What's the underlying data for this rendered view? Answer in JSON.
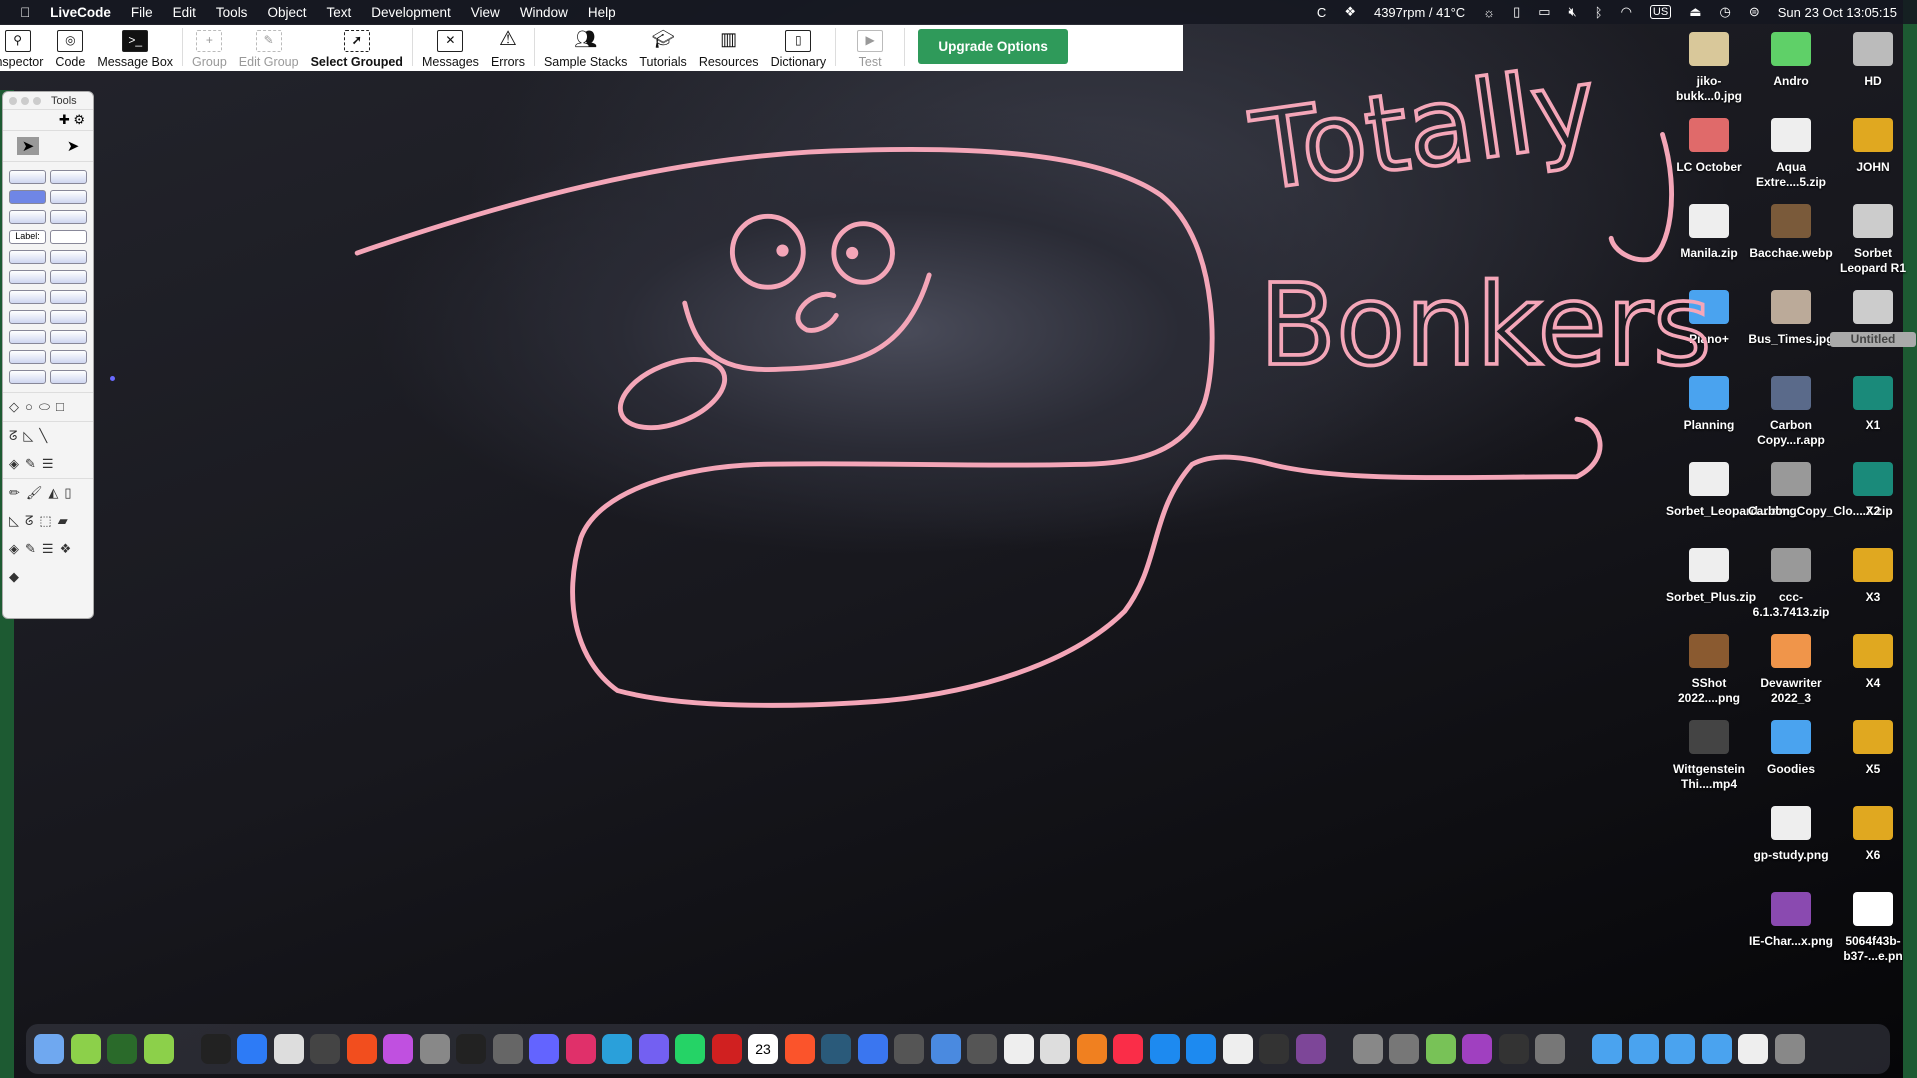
{
  "menubar": {
    "app": "LiveCode",
    "items": [
      "File",
      "Edit",
      "Tools",
      "Object",
      "Text",
      "Development",
      "View",
      "Window",
      "Help"
    ],
    "status": {
      "fan": "4397rpm / 41°C",
      "keyboard": "US",
      "datetime": "Sun 23 Oct  13:05:15"
    }
  },
  "toolbar": {
    "items": [
      {
        "label": "Inspector",
        "icon": "inspector-icon",
        "state": "enabled"
      },
      {
        "label": "Code",
        "icon": "code-icon",
        "state": "enabled"
      },
      {
        "label": "Message Box",
        "icon": "message-box-icon",
        "state": "enabled"
      },
      {
        "label": "Group",
        "icon": "group-icon",
        "state": "disabled"
      },
      {
        "label": "Edit Group",
        "icon": "edit-group-icon",
        "state": "disabled"
      },
      {
        "label": "Select Grouped",
        "icon": "select-grouped-icon",
        "state": "bold"
      },
      {
        "label": "Messages",
        "icon": "messages-icon",
        "state": "enabled"
      },
      {
        "label": "Errors",
        "icon": "errors-icon",
        "state": "enabled"
      },
      {
        "label": "Sample Stacks",
        "icon": "sample-stacks-icon",
        "state": "enabled"
      },
      {
        "label": "Tutorials",
        "icon": "tutorials-icon",
        "state": "enabled"
      },
      {
        "label": "Resources",
        "icon": "resources-icon",
        "state": "enabled"
      },
      {
        "label": "Dictionary",
        "icon": "dictionary-icon",
        "state": "enabled"
      },
      {
        "label": "Test",
        "icon": "test-icon",
        "state": "disabled"
      }
    ],
    "upgrade": "Upgrade Options"
  },
  "tools_palette": {
    "title": "Tools",
    "label_tool": "Label:"
  },
  "drawing": {
    "line1": "Totally",
    "line2": "Bonkers",
    "color": "#f4a6b8"
  },
  "desktop": {
    "columns": [
      [
        {
          "label": "jiko-bukk...0.jpg",
          "color": "#d9c89a"
        },
        {
          "label": "LC October",
          "color": "#e06a6a"
        },
        {
          "label": "Manila.zip",
          "color": "#eeeeee"
        },
        {
          "label": "Piano+",
          "color": "#4aa3ef"
        },
        {
          "label": "Planning",
          "color": "#4aa3ef"
        },
        {
          "label": "Sorbet_Leopard....dmg",
          "color": "#eeeeee"
        },
        {
          "label": "Sorbet_Plus.zip",
          "color": "#eeeeee"
        },
        {
          "label": "SShot 2022....png",
          "color": "#8a5a30"
        },
        {
          "label": "Wittgenstein Thi....mp4",
          "color": "#444"
        }
      ],
      [
        {
          "label": "Andro",
          "color": "#5fd068"
        },
        {
          "label": "Aqua Extre....5.zip",
          "color": "#eeeeee"
        },
        {
          "label": "Bacchae.webp",
          "color": "#7a5a3a"
        },
        {
          "label": "Bus_Times.jpg",
          "color": "#bbaa99"
        },
        {
          "label": "Carbon Copy...r.app",
          "color": "#5a6a8a"
        },
        {
          "label": "Carbon_Copy_Clo....7.zip",
          "color": "#999999"
        },
        {
          "label": "ccc-6.1.3.7413.zip",
          "color": "#999999"
        },
        {
          "label": "Devawriter 2022_3",
          "color": "#f0954a"
        },
        {
          "label": "Goodies",
          "color": "#4aa3ef"
        },
        {
          "label": "gp-study.png",
          "color": "#eeeeee"
        },
        {
          "label": "IE-Char...x.png",
          "color": "#8a4ab0"
        }
      ],
      [
        {
          "label": "HD",
          "color": "#bbbbbb"
        },
        {
          "label": "JOHN",
          "color": "#e0a820"
        },
        {
          "label": "Sorbet Leopard R1",
          "color": "#cccccc"
        },
        {
          "label": "Untitled",
          "color": "#cccccc"
        },
        {
          "label": "X1",
          "color": "#1a8a7a"
        },
        {
          "label": "X2",
          "color": "#1a8a7a"
        },
        {
          "label": "X3",
          "color": "#e0a820"
        },
        {
          "label": "X4",
          "color": "#e0a820"
        },
        {
          "label": "X5",
          "color": "#e0a820"
        },
        {
          "label": "X6",
          "color": "#e0a820"
        },
        {
          "label": "5064f43b-b37-...e.pn",
          "color": "#ffffff"
        }
      ]
    ]
  },
  "dock": {
    "apps": [
      "finder",
      "livecode",
      "livecode",
      "livecode",
      "terminal",
      "zoom",
      "fontforge",
      "figma",
      "figma",
      "color",
      "pen",
      "inkscape",
      "calculator",
      "mastodon",
      "slack",
      "telegram",
      "viber",
      "whatsapp",
      "pdf",
      "calendar",
      "brave",
      "vectorworks",
      "signal",
      "scanner",
      "maps",
      "cog",
      "textedit",
      "script",
      "vlc",
      "music",
      "appstore",
      "appstore",
      "preview",
      "keyboard",
      "tor",
      "settings",
      "disk",
      "android",
      "speech",
      "monitor",
      "carbon",
      "folder",
      "folder",
      "folder",
      "folder",
      "preview",
      "trash"
    ],
    "calendar_day": "23"
  }
}
